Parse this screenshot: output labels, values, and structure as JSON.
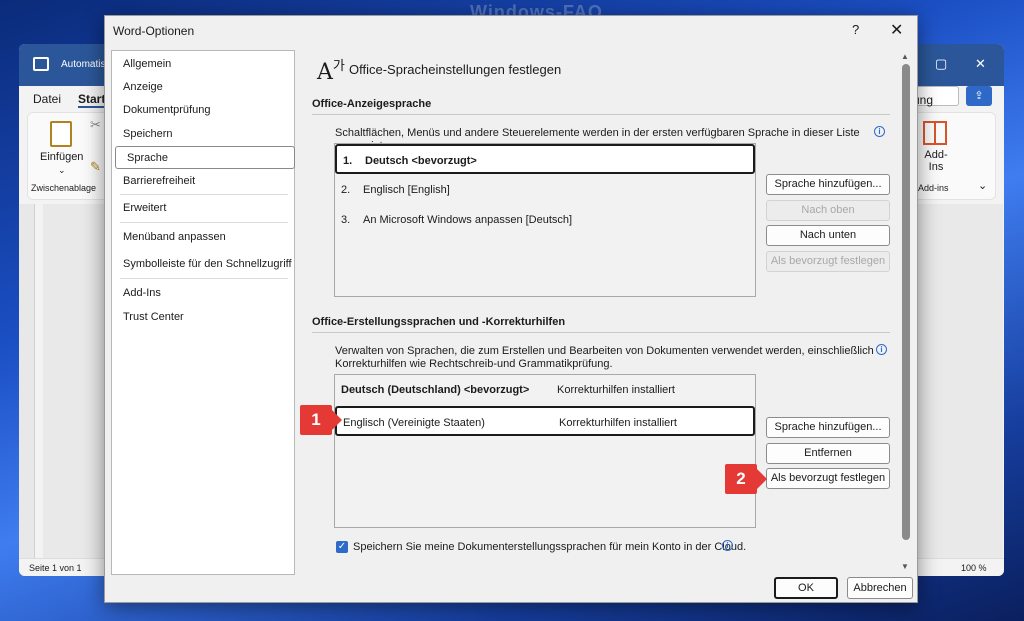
{
  "watermark": "Windows-FAQ",
  "word": {
    "title": "Automatisches Speichern",
    "tabs": [
      "Datei",
      "Start"
    ],
    "ribbon": {
      "paste_label": "Einfügen",
      "clipboard_group": "Zwischenablage",
      "addins_label": "Add-Ins",
      "addins_group": "Add-ins",
      "search_partial": "itung"
    },
    "status": {
      "page": "Seite 1 von 1",
      "zoom": "100 %"
    }
  },
  "dialog": {
    "title": "Word-Optionen",
    "help": "?",
    "close": "✕",
    "nav": [
      {
        "label": "Allgemein"
      },
      {
        "label": "Anzeige"
      },
      {
        "label": "Dokumentprüfung"
      },
      {
        "label": "Speichern"
      },
      {
        "label": "Sprache",
        "selected": true
      },
      {
        "label": "Barrierefreiheit"
      },
      {
        "label": "Erweitert"
      },
      {
        "label": "Menüband anpassen"
      },
      {
        "label": "Symbolleiste für den Schnellzugriff"
      },
      {
        "label": "Add-Ins"
      },
      {
        "label": "Trust Center"
      }
    ],
    "heading": "Office-Spracheinstellungen festlegen",
    "display_section": {
      "title": "Office-Anzeigesprache",
      "description": "Schaltflächen, Menüs und andere Steuerelemente werden in der ersten verfügbaren Sprache in dieser Liste angezeigt.",
      "items": [
        {
          "num": "1.",
          "label": "Deutsch <bevorzugt>",
          "selected": true
        },
        {
          "num": "2.",
          "label": "Englisch [English]"
        },
        {
          "num": "3.",
          "label": "An Microsoft Windows anpassen [Deutsch]"
        }
      ],
      "buttons": {
        "add": "Sprache hinzufügen...",
        "up": "Nach oben",
        "down": "Nach unten",
        "preferred": "Als bevorzugt festlegen"
      }
    },
    "authoring_section": {
      "title": "Office-Erstellungssprachen und -Korrekturhilfen",
      "description_line1": "Verwalten von Sprachen, die zum Erstellen und Bearbeiten von Dokumenten verwendet werden, einschließlich",
      "description_line2": "Korrekturhilfen wie Rechtschreib-und Grammatikprüfung.",
      "items": [
        {
          "language": "Deutsch (Deutschland) <bevorzugt>",
          "status": "Korrekturhilfen installiert"
        },
        {
          "language": "Englisch (Vereinigte Staaten)",
          "status": "Korrekturhilfen installiert",
          "selected": true
        }
      ],
      "buttons": {
        "add": "Sprache hinzufügen...",
        "remove": "Entfernen",
        "preferred": "Als bevorzugt festlegen"
      }
    },
    "checkbox_label": "Speichern Sie meine Dokumenterstellungssprachen für mein Konto in der Cloud.",
    "checkbox_checked": true,
    "ok": "OK",
    "cancel": "Abbrechen",
    "markers": [
      "1",
      "2"
    ]
  }
}
